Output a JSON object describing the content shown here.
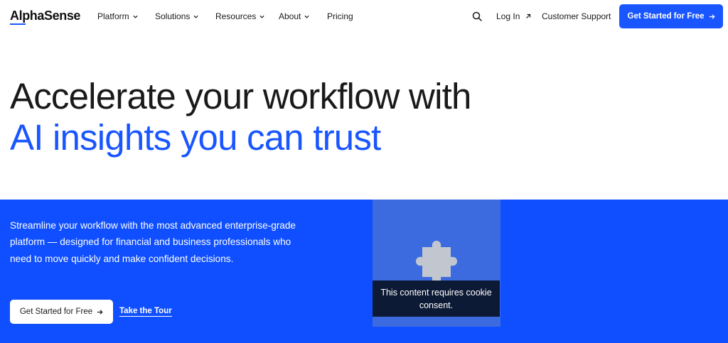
{
  "brand": {
    "name": "AlphaSense",
    "accent": "#1a56ff"
  },
  "nav": {
    "items": [
      {
        "label": "Platform",
        "has_dropdown": true
      },
      {
        "label": "Solutions",
        "has_dropdown": true
      },
      {
        "label": "Resources",
        "has_dropdown": true
      },
      {
        "label": "About",
        "has_dropdown": true
      },
      {
        "label": "Pricing",
        "has_dropdown": false
      }
    ],
    "search_icon": "search-icon",
    "login_label": "Log In",
    "support_label": "Customer Support",
    "cta_label": "Get Started for Free"
  },
  "hero": {
    "line1": "Accelerate your workflow with",
    "line2": "AI insights you can trust"
  },
  "band": {
    "description": "Streamline your workflow with the most advanced enterprise-grade platform — designed for financial and business professionals who need to move quickly and make confident decisions.",
    "primary_cta": "Get Started for Free",
    "secondary_cta": "Take the Tour",
    "color": "#0f4fff"
  },
  "media": {
    "consent_text": "This content requires cookie consent.",
    "icon": "puzzle-icon"
  }
}
